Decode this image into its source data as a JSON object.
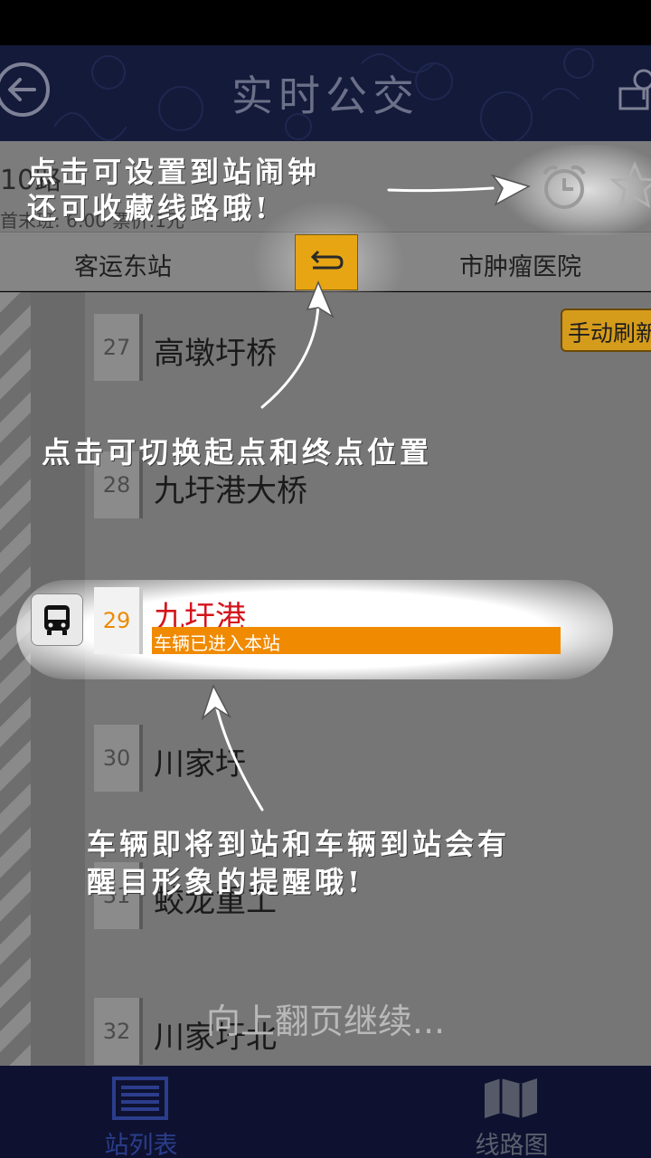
{
  "header": {
    "title": "实时公交"
  },
  "route": {
    "number": "10路",
    "meta": "首末班: 6:00   票价:1元"
  },
  "ends": {
    "from": "客运东站",
    "to": "市肿瘤医院"
  },
  "refresh_label": "手动刷新",
  "stations": [
    {
      "num": "27",
      "name": "高墩圩桥"
    },
    {
      "num": "28",
      "name": "九圩港大桥"
    },
    {
      "num": "30",
      "name": "川家圩"
    },
    {
      "num": "31",
      "name": "蛟龙重工"
    },
    {
      "num": "32",
      "name": "川家圩北"
    }
  ],
  "current": {
    "num": "29",
    "name": "九圩港",
    "status": "车辆已进入本站"
  },
  "hints": {
    "alarm_line1": "点击可设置到站闹钟",
    "alarm_line2": "还可收藏线路哦!",
    "swap": "点击可切换起点和终点位置",
    "arrive_line1": "车辆即将到站和车辆到站会有",
    "arrive_line2": "醒目形象的提醒哦!"
  },
  "continue_hint": "向上翻页继续...",
  "nav": {
    "stations_label": "站列表",
    "map_label": "线路图"
  },
  "colors": {
    "accent": "#f08a00",
    "current_station": "#d4141c",
    "swap_button": "#e7a514",
    "header_bg": "#131a3a"
  }
}
